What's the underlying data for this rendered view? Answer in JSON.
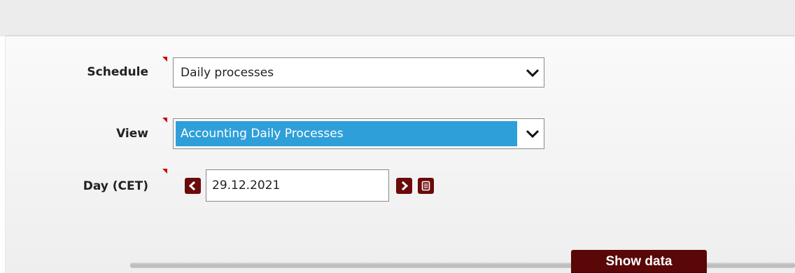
{
  "form": {
    "schedule": {
      "label": "Schedule",
      "value": "Daily processes",
      "chevron_icon": "chevron-down-icon"
    },
    "view": {
      "label": "View",
      "value": "Accounting Daily Processes",
      "chevron_icon": "chevron-down-icon",
      "highlight_color": "#2f9fd9"
    },
    "day": {
      "label": "Day (CET)",
      "value": "29.12.2021",
      "prev_icon": "chevron-left-icon",
      "next_icon": "chevron-right-icon",
      "calendar_icon": "calendar-icon"
    },
    "required_marker_color": "#cc0000"
  },
  "actions": {
    "show_data_label": "Show data",
    "button_color": "#5a0707"
  }
}
